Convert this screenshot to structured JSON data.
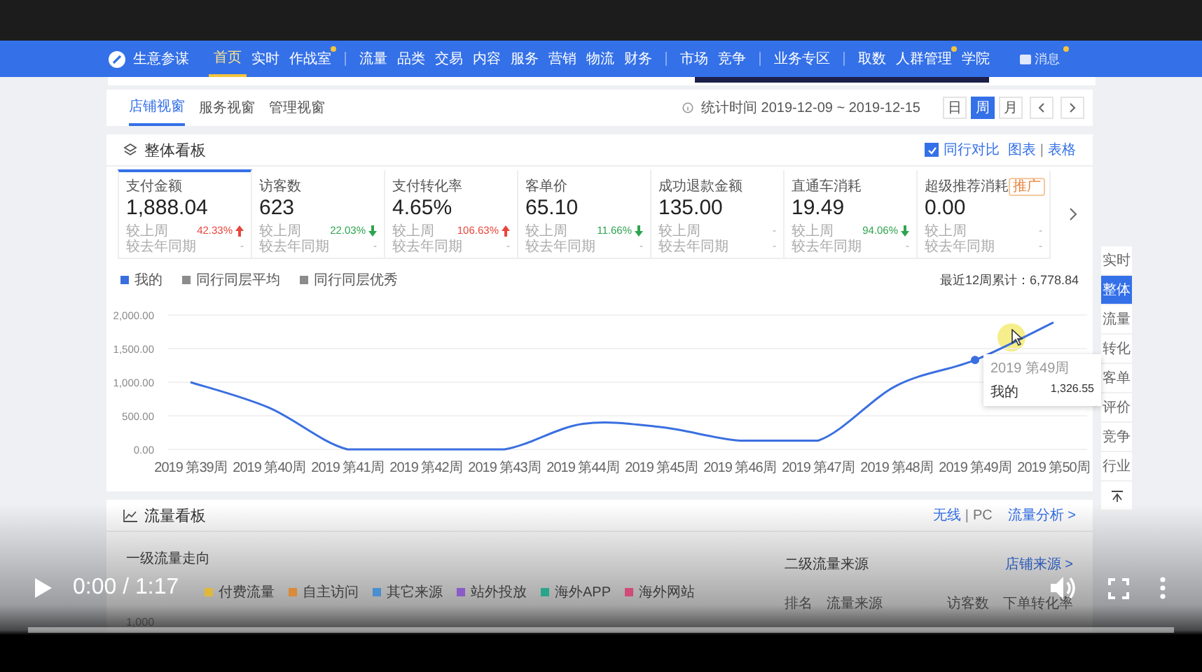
{
  "nav": {
    "logo_text": "生意参谋",
    "groups": [
      [
        {
          "label": "首页",
          "selected": true,
          "dot": false
        },
        {
          "label": "实时",
          "selected": false,
          "dot": false
        },
        {
          "label": "作战室",
          "selected": false,
          "dot": true
        }
      ],
      [
        {
          "label": "流量",
          "selected": false,
          "dot": false
        },
        {
          "label": "品类",
          "selected": false,
          "dot": false
        },
        {
          "label": "交易",
          "selected": false,
          "dot": false
        },
        {
          "label": "内容",
          "selected": false,
          "dot": false
        },
        {
          "label": "服务",
          "selected": false,
          "dot": false
        },
        {
          "label": "营销",
          "selected": false,
          "dot": false
        },
        {
          "label": "物流",
          "selected": false,
          "dot": false
        },
        {
          "label": "财务",
          "selected": false,
          "dot": false
        }
      ],
      [
        {
          "label": "市场",
          "selected": false,
          "dot": false
        },
        {
          "label": "竞争",
          "selected": false,
          "dot": false
        }
      ],
      [
        {
          "label": "业务专区",
          "selected": false,
          "dot": false
        }
      ],
      [
        {
          "label": "取数",
          "selected": false,
          "dot": false
        },
        {
          "label": "人群管理",
          "selected": false,
          "dot": true
        },
        {
          "label": "学院",
          "selected": false,
          "dot": false
        }
      ]
    ],
    "message": {
      "label": "消息",
      "dot": true
    }
  },
  "view_tabs": [
    {
      "label": "店铺视窗",
      "selected": true
    },
    {
      "label": "服务视窗",
      "selected": false
    },
    {
      "label": "管理视窗",
      "selected": false
    }
  ],
  "stat_period": "统计时间 2019-12-09 ~ 2019-12-15",
  "period_buttons": [
    {
      "label": "日",
      "selected": false
    },
    {
      "label": "周",
      "selected": true
    },
    {
      "label": "月",
      "selected": false
    }
  ],
  "overview": {
    "title": "整体看板",
    "compare": {
      "label": "同行对比",
      "checked": true
    },
    "view_links": [
      "图表",
      "表格"
    ],
    "link_separator": "|",
    "metrics": [
      {
        "label": "支付金额",
        "value": "1,888.04",
        "selected": true,
        "rows": [
          {
            "label": "较上周",
            "change": "42.33%",
            "kind": "rise"
          },
          {
            "label": "较去年同期",
            "change": "-",
            "kind": "flat"
          }
        ]
      },
      {
        "label": "访客数",
        "value": "623",
        "selected": false,
        "rows": [
          {
            "label": "较上周",
            "change": "22.03%",
            "kind": "fall"
          },
          {
            "label": "较去年同期",
            "change": "-",
            "kind": "flat"
          }
        ]
      },
      {
        "label": "支付转化率",
        "value": "4.65%",
        "selected": false,
        "rows": [
          {
            "label": "较上周",
            "change": "106.63%",
            "kind": "rise"
          },
          {
            "label": "较去年同期",
            "change": "-",
            "kind": "flat"
          }
        ]
      },
      {
        "label": "客单价",
        "value": "65.10",
        "selected": false,
        "rows": [
          {
            "label": "较上周",
            "change": "11.66%",
            "kind": "fall"
          },
          {
            "label": "较去年同期",
            "change": "-",
            "kind": "flat"
          }
        ]
      },
      {
        "label": "成功退款金额",
        "value": "135.00",
        "selected": false,
        "rows": [
          {
            "label": "较上周",
            "change": "-",
            "kind": "flat"
          },
          {
            "label": "较去年同期",
            "change": "-",
            "kind": "flat"
          }
        ]
      },
      {
        "label": "直通车消耗",
        "value": "19.49",
        "selected": false,
        "rows": [
          {
            "label": "较上周",
            "change": "94.06%",
            "kind": "fall"
          },
          {
            "label": "较去年同期",
            "change": "-",
            "kind": "flat"
          }
        ]
      },
      {
        "label": "超级推荐消耗",
        "value": "0.00",
        "selected": false,
        "badge": "推广",
        "rows": [
          {
            "label": "较上周",
            "change": "-",
            "kind": "flat"
          },
          {
            "label": "较去年同期",
            "change": "-",
            "kind": "flat"
          }
        ]
      }
    ],
    "total": "最近12周累计：6,778.84",
    "chart_data": {
      "type": "line",
      "grid": true,
      "categories": [
        "2019 第39周",
        "2019 第40周",
        "2019 第41周",
        "2019 第42周",
        "2019 第43周",
        "2019 第44周",
        "2019 第45周",
        "2019 第46周",
        "2019 第47周",
        "2019 第48周",
        "2019 第49周",
        "2019 第50周"
      ],
      "series": [
        {
          "name": "我的",
          "color": "#3b6fe0",
          "values": [
            1000,
            620,
            0,
            0,
            0,
            380,
            330,
            130,
            130,
            950,
            1330,
            1890
          ]
        },
        {
          "name": "同行同层平均",
          "color": "#8c8c8c",
          "values": [
            null,
            null,
            null,
            null,
            null,
            null,
            null,
            null,
            null,
            null,
            null,
            null
          ]
        },
        {
          "name": "同行同层优秀",
          "color": "#8c8c8c",
          "values": [
            null,
            null,
            null,
            null,
            null,
            null,
            null,
            null,
            null,
            null,
            null,
            null
          ]
        }
      ],
      "ylim": [
        0,
        2000
      ],
      "yticks": [
        {
          "value": 0,
          "label": "0.00"
        },
        {
          "value": 500,
          "label": "500.00"
        },
        {
          "value": 1000,
          "label": "1,000.00"
        },
        {
          "value": 1500,
          "label": "1,500.00"
        },
        {
          "value": 2000,
          "label": "2,000.00"
        }
      ]
    },
    "tooltip": {
      "title": "2019 第49周",
      "name": "我的",
      "value": "1,326.55"
    }
  },
  "side_nav": [
    {
      "label": "实时",
      "selected": false
    },
    {
      "label": "整体",
      "selected": true
    },
    {
      "label": "流量",
      "selected": false
    },
    {
      "label": "转化",
      "selected": false
    },
    {
      "label": "客单",
      "selected": false
    },
    {
      "label": "评价",
      "selected": false
    },
    {
      "label": "竞争",
      "selected": false
    },
    {
      "label": "行业",
      "selected": false
    }
  ],
  "flow": {
    "title": "流量看板",
    "device_links": [
      "无线",
      "PC"
    ],
    "link_separator": "|",
    "analysis_link": "流量分析 >",
    "primary_title": "一级流量走向",
    "legend": [
      {
        "label": "付费流量",
        "color": "#e0b93a"
      },
      {
        "label": "自主访问",
        "color": "#d98a3a"
      },
      {
        "label": "其它来源",
        "color": "#4a8fd0"
      },
      {
        "label": "站外投放",
        "color": "#8a5cc8"
      },
      {
        "label": "海外APP",
        "color": "#2aa58a"
      },
      {
        "label": "海外网站",
        "color": "#d04a7a"
      }
    ],
    "y_label": "1,000",
    "secondary_title": "二级流量来源",
    "shop_link": "店铺来源 >",
    "columns": [
      "排名",
      "流量来源",
      "访客数",
      "下单转化率"
    ]
  },
  "player": {
    "time": "0:00 / 1:17",
    "level": 0
  }
}
